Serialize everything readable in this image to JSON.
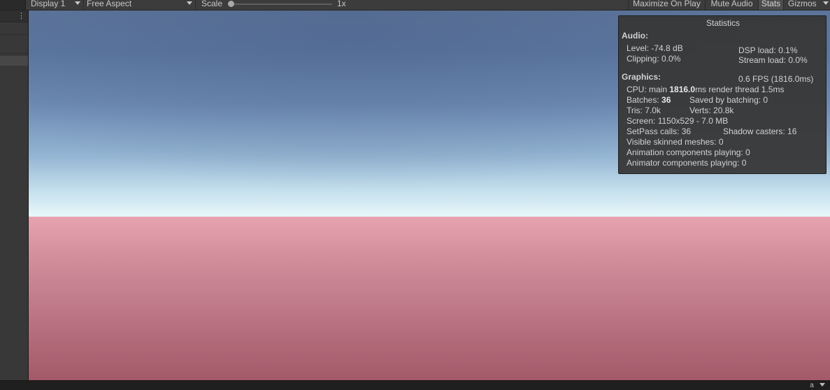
{
  "toolbar": {
    "display_dropdown": "Display 1",
    "aspect_dropdown": "Free Aspect",
    "scale_label": "Scale",
    "scale_value": "1x",
    "scale_fraction": 0.0,
    "maximize_on_play": "Maximize On Play",
    "mute_audio": "Mute Audio",
    "stats": "Stats",
    "gizmos": "Gizmos"
  },
  "left_panel": {
    "menu_icon": "kebab-menu-icon"
  },
  "stats": {
    "title": "Statistics",
    "audio_heading": "Audio:",
    "level": "Level: -74.8 dB",
    "clipping": "Clipping: 0.0%",
    "dsp_load": "DSP load: 0.1%",
    "stream_load": "Stream load: 0.0%",
    "graphics_heading": "Graphics:",
    "fps": "0.6 FPS (1816.0ms)",
    "cpu_prefix": "CPU: main ",
    "cpu_main_value": "1816.0",
    "cpu_suffix": "ms  render thread 1.5ms",
    "batches_prefix": "Batches: ",
    "batches_value": "36",
    "saved_by_batching": "Saved by batching: 0",
    "tris": "Tris: 7.0k",
    "verts": "Verts: 20.8k",
    "screen": "Screen: 1150x529 - 7.0 MB",
    "setpass_calls": "SetPass calls: 36",
    "shadow_casters": "Shadow casters: 16",
    "visible_skinned_meshes": "Visible skinned meshes: 0",
    "animation_components": "Animation components playing: 0",
    "animator_components": "Animator components playing: 0"
  },
  "statusbar": {
    "icon": "lock-icon",
    "icon_glyph": "a"
  },
  "colors": {
    "toolbar_bg": "#3c3c3c",
    "panel_bg": "#383838",
    "sky_top": "#5c7499",
    "horizon": "#eaf8fb",
    "ground_near": "#e7a3b0",
    "ground_far": "#a35968",
    "stats_bg": "#383838"
  }
}
